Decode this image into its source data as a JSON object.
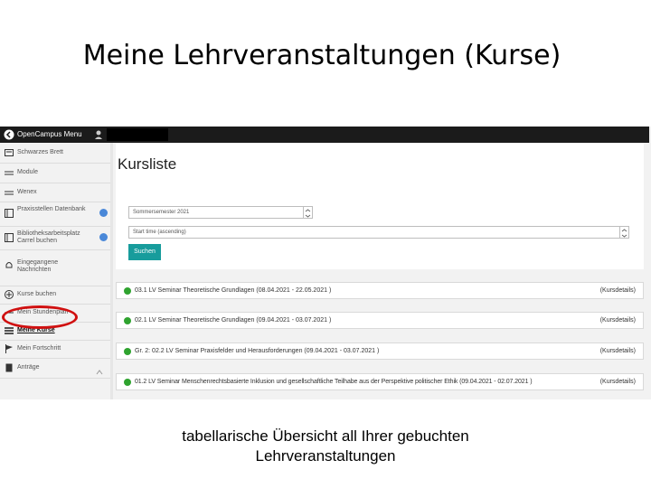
{
  "slide": {
    "title": "Meine Lehrveranstaltungen (Kurse)",
    "caption_line1": "tabellarische Übersicht all Ihrer gebuchten",
    "caption_line2": "Lehrveranstaltungen"
  },
  "topbar": {
    "menu_label": "OpenCampus Menu"
  },
  "sidebar": {
    "items": [
      {
        "label": "Schwarzes Brett",
        "icon": "bulletin-icon"
      },
      {
        "label": "Module",
        "icon": "list-icon"
      },
      {
        "label": "Wenex",
        "icon": "list-icon"
      },
      {
        "label": "Praxisstellen Datenbank",
        "icon": "database-icon",
        "expand": true
      },
      {
        "label": "Bibliotheksarbeitsplatz Carrel buchen",
        "icon": "library-icon",
        "expand": true
      },
      {
        "label": "Eingegangene Nachrichten",
        "icon": "bell-icon"
      },
      {
        "label": "Kurse buchen",
        "icon": "plus-circle-icon"
      },
      {
        "label": "Mein Stundenplan",
        "icon": "list-icon"
      },
      {
        "label": "Meine Kurse",
        "icon": "list-icon",
        "active": true
      },
      {
        "label": "Mein Fortschritt",
        "icon": "flag-icon"
      },
      {
        "label": "Anträge",
        "icon": "document-icon"
      }
    ]
  },
  "main": {
    "heading": "Kursliste",
    "semester_select": "Sommersemester 2021",
    "sort_select": "Start time (ascending)",
    "search_button": "Suchen",
    "details_label": "(Kursdetails)",
    "courses": [
      {
        "title": "03.1 LV Seminar Theoretische Grundlagen (08.04.2021 - 22.05.2021 )"
      },
      {
        "title": "02.1 LV Seminar Theoretische Grundlagen (09.04.2021 - 03.07.2021 )"
      },
      {
        "title": "Gr. 2: 02.2 LV Seminar Praxisfelder und Herausforderungen (09.04.2021 - 03.07.2021 )"
      },
      {
        "title": "01.2 LV Seminar Menschenrechtsbasierte Inklusion und gesellschaftliche Teilhabe aus der Perspektive politischer Ethik (09.04.2021 - 02.07.2021 )"
      }
    ]
  },
  "colors": {
    "accent": "#179c9c",
    "status_green": "#2fa32f",
    "highlight_red": "#d01010",
    "topbar": "#1b1b1b"
  }
}
